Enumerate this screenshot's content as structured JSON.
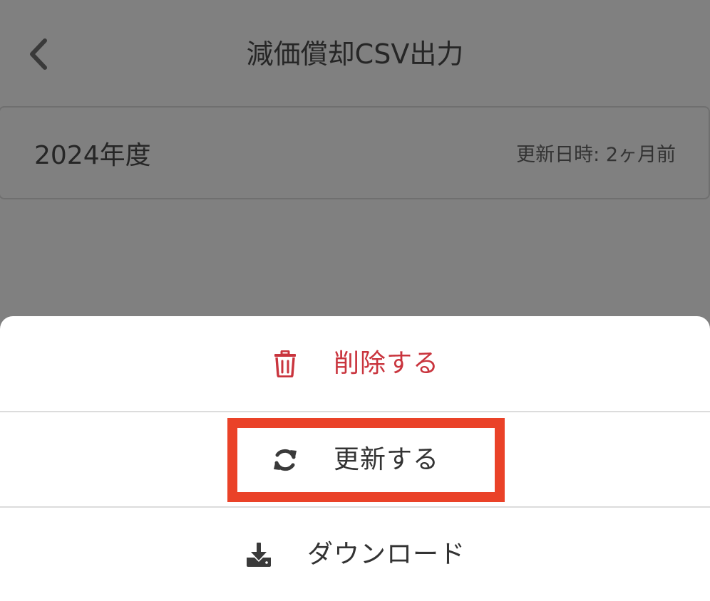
{
  "header": {
    "title": "減価償却CSV出力",
    "back_icon": "chevron-left-icon"
  },
  "year_card": {
    "year": "2024年度",
    "updated": "更新日時: 2ヶ月前"
  },
  "action_sheet": {
    "items": [
      {
        "label": "削除する",
        "icon": "trash-icon",
        "color": "#c9343d"
      },
      {
        "label": "更新する",
        "icon": "refresh-icon",
        "color": "#333333"
      },
      {
        "label": "ダウンロード",
        "icon": "download-icon",
        "color": "#333333"
      }
    ]
  },
  "colors": {
    "overlay": "#808080",
    "danger": "#c9343d",
    "highlight": "#ea4228",
    "text": "#333333"
  }
}
